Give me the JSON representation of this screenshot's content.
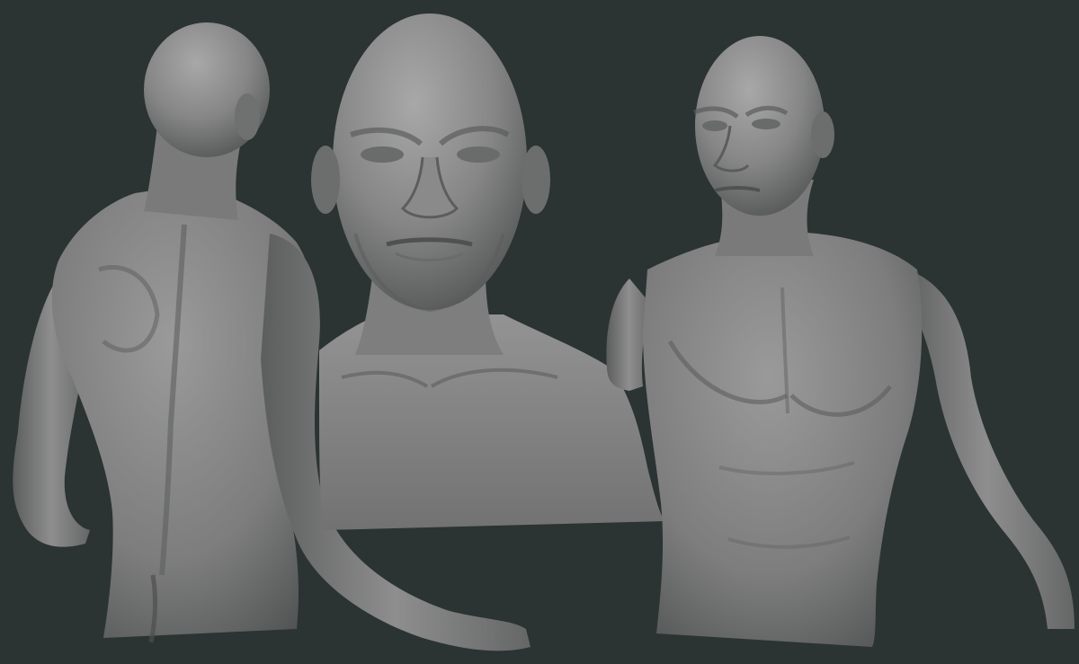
{
  "scene": {
    "background_color": "#2b3333",
    "clay_color": "#7c7c7c",
    "clay_highlight": "#a4a4a4",
    "clay_shadow": "#4e4f4f",
    "views": [
      {
        "name": "back-three-quarter-view"
      },
      {
        "name": "front-bust-view"
      },
      {
        "name": "front-three-quarter-view"
      }
    ]
  }
}
